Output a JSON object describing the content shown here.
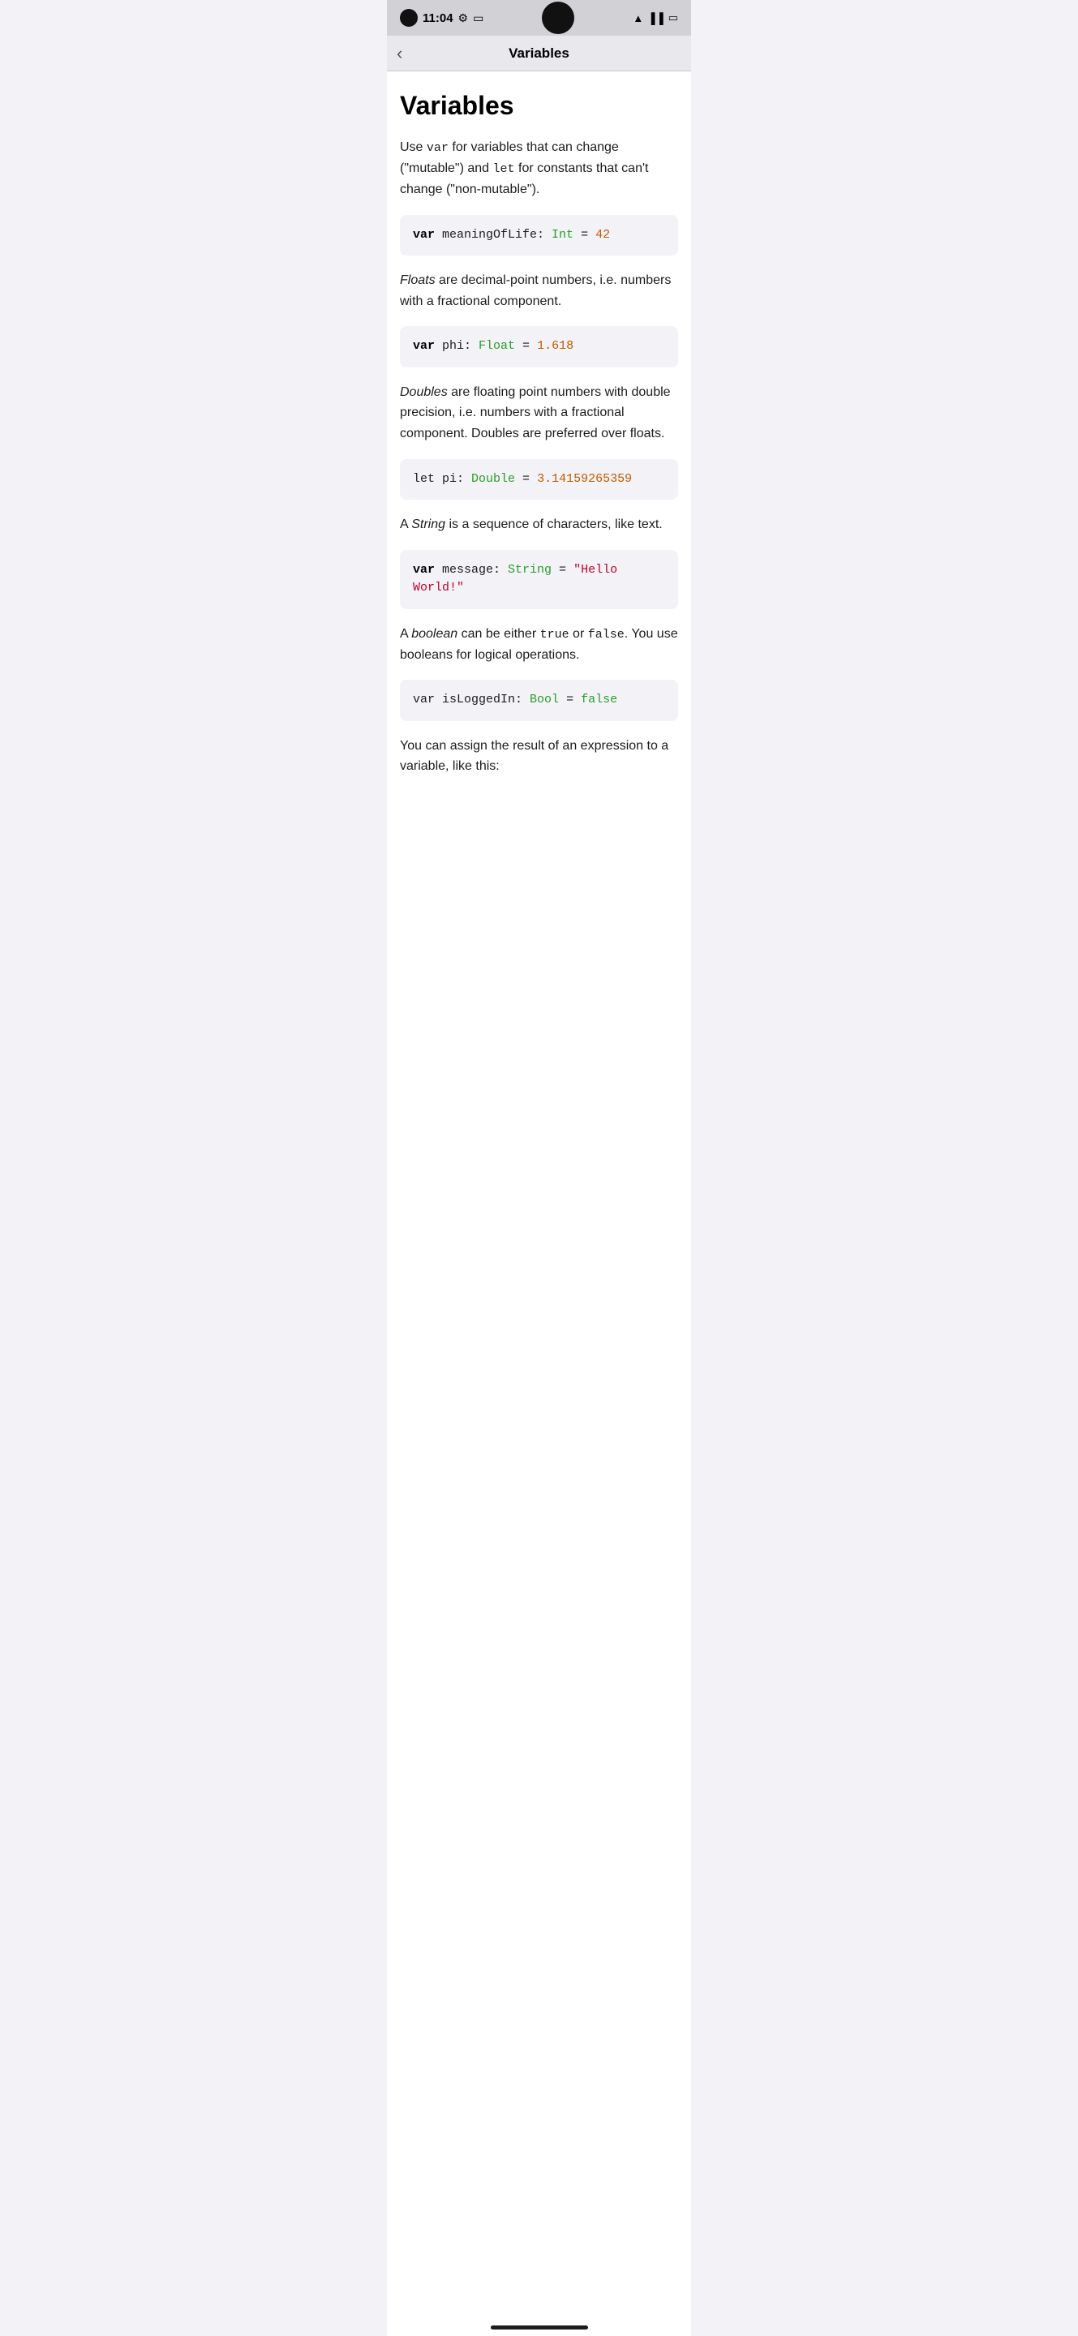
{
  "statusBar": {
    "time": "11:04",
    "icons": [
      "settings",
      "sim"
    ],
    "rightIcons": [
      "wifi",
      "signal",
      "battery"
    ]
  },
  "navBar": {
    "title": "Variables",
    "backLabel": "‹"
  },
  "content": {
    "pageTitle": "Variables",
    "sections": [
      {
        "type": "text",
        "html": false,
        "text": "Use var for variables that can change (\"mutable\") and let for constants that can't change (\"non-mutable\")."
      },
      {
        "type": "code",
        "tokens": [
          {
            "kind": "kw",
            "text": "var"
          },
          {
            "kind": "plain",
            "text": " meaningOfLife: "
          },
          {
            "kind": "type",
            "text": "Int"
          },
          {
            "kind": "plain",
            "text": " = "
          },
          {
            "kind": "num",
            "text": "42"
          }
        ]
      },
      {
        "type": "text",
        "text": "Floats are decimal-point numbers, i.e. numbers with a fractional component."
      },
      {
        "type": "code",
        "tokens": [
          {
            "kind": "kw",
            "text": "var"
          },
          {
            "kind": "plain",
            "text": " phi: "
          },
          {
            "kind": "type",
            "text": "Float"
          },
          {
            "kind": "plain",
            "text": " = "
          },
          {
            "kind": "num",
            "text": "1.618"
          }
        ]
      },
      {
        "type": "text",
        "text": "Doubles are floating point numbers with double precision, i.e. numbers with a fractional component. Doubles are preferred over floats."
      },
      {
        "type": "code",
        "tokens": [
          {
            "kind": "plain",
            "text": "let"
          },
          {
            "kind": "plain",
            "text": " pi: "
          },
          {
            "kind": "type",
            "text": "Double"
          },
          {
            "kind": "plain",
            "text": " = "
          },
          {
            "kind": "num",
            "text": "3.14159265359"
          }
        ]
      },
      {
        "type": "text",
        "text": "A String is a sequence of characters, like text."
      },
      {
        "type": "code",
        "tokens": [
          {
            "kind": "kw",
            "text": "var"
          },
          {
            "kind": "plain",
            "text": " message: "
          },
          {
            "kind": "type",
            "text": "String"
          },
          {
            "kind": "plain",
            "text": " = "
          },
          {
            "kind": "str",
            "text": "\"Hello World!\""
          }
        ]
      },
      {
        "type": "text",
        "text": "A boolean can be either true or false. You use booleans for logical operations."
      },
      {
        "type": "code",
        "tokens": [
          {
            "kind": "plain",
            "text": "var"
          },
          {
            "kind": "plain",
            "text": " isLoggedIn: "
          },
          {
            "kind": "type",
            "text": "Bool"
          },
          {
            "kind": "plain",
            "text": " = "
          },
          {
            "kind": "bool-val",
            "text": "false"
          }
        ]
      },
      {
        "type": "text",
        "text": "You can assign the result of an expression to a variable, like this:"
      }
    ]
  }
}
